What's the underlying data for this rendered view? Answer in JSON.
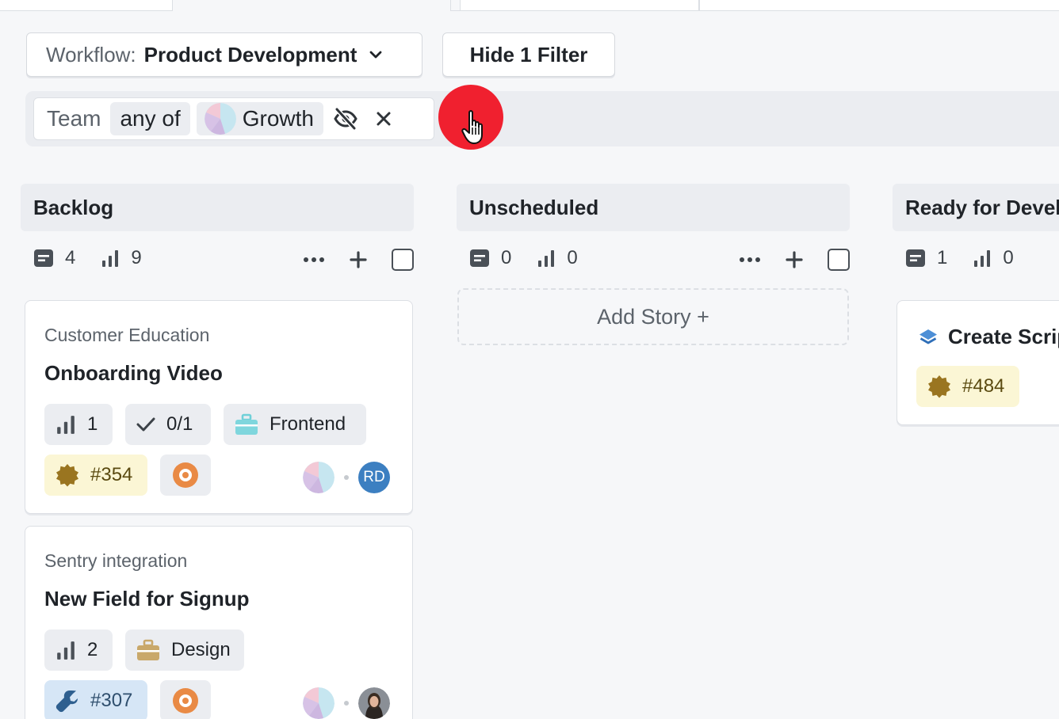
{
  "toolbar": {
    "workflow_label": "Workflow:",
    "workflow_value": "Product Development",
    "hide_filter_label": "Hide 1 Filter"
  },
  "filter": {
    "field": "Team",
    "operator": "any of",
    "value": "Growth"
  },
  "icons": {
    "chevron": "chevron-down-icon",
    "visibility": "eye-off-icon",
    "remove": "close-icon",
    "stories": "story-count-icon",
    "estimate": "estimate-bars-icon",
    "more": "more-dots-icon",
    "add": "plus-icon",
    "cursor": "hand-pointer-icon"
  },
  "colors": {
    "accent_red": "#f0202f",
    "label_yellow": "#fbf6d5",
    "label_blue": "#d6e6f6",
    "avatar_blue": "#3c7fc1"
  },
  "columns": [
    {
      "name": "Backlog",
      "story_count": "4",
      "estimate": "9",
      "cards": [
        {
          "epic": "Customer Education",
          "title": "Onboarding Video",
          "estimate": "1",
          "tasks": "0/1",
          "group": "Frontend",
          "ref": "#354",
          "owner_initials": "RD"
        },
        {
          "epic": "Sentry integration",
          "title": "New Field for Signup",
          "estimate": "2",
          "group": "Design",
          "ref": "#307"
        }
      ]
    },
    {
      "name": "Unscheduled",
      "story_count": "0",
      "estimate": "0",
      "add_story_label": "Add Story +"
    },
    {
      "name": "Ready for Development",
      "story_count": "1",
      "estimate": "0",
      "cards": [
        {
          "title": "Create Script",
          "ref": "#484"
        }
      ]
    }
  ]
}
